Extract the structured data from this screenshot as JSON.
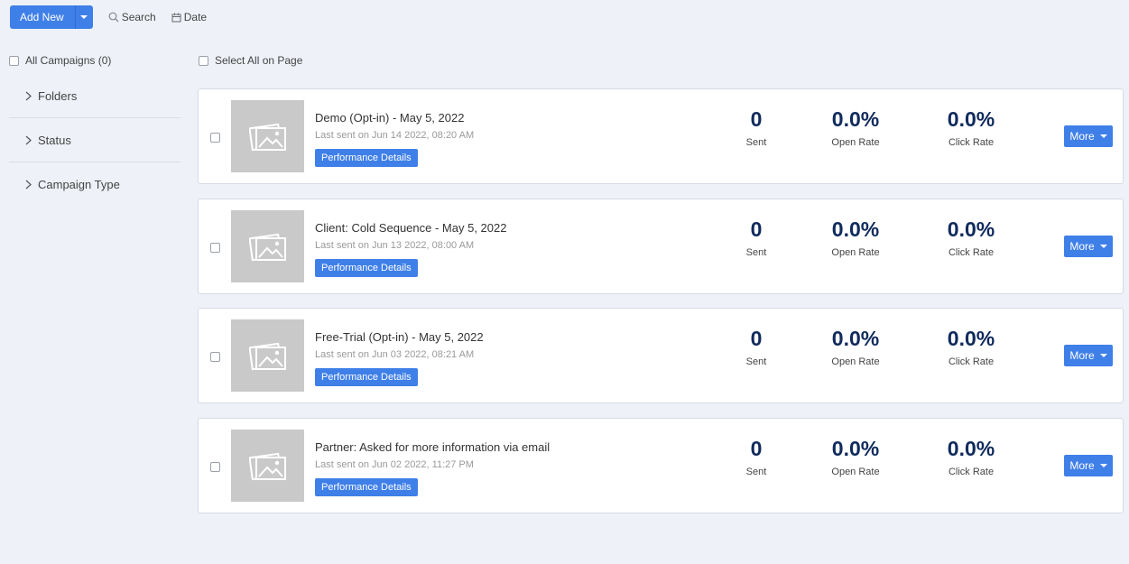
{
  "toolbar": {
    "add_new_label": "Add New",
    "search_label": "Search",
    "date_label": "Date"
  },
  "sidebar": {
    "all_campaigns_label": "All Campaigns (0)",
    "filters": [
      {
        "label": "Folders"
      },
      {
        "label": "Status"
      },
      {
        "label": "Campaign Type"
      }
    ]
  },
  "select_all_label": "Select All on Page",
  "campaigns": [
    {
      "title": "Demo (Opt-in) - May 5, 2022",
      "last_sent": "Last sent on Jun 14 2022, 08:20 AM",
      "performance_label": "Performance Details",
      "sent": "0",
      "sent_label": "Sent",
      "open_rate": "0.0%",
      "open_rate_label": "Open Rate",
      "click_rate": "0.0%",
      "click_rate_label": "Click Rate",
      "more_label": "More"
    },
    {
      "title": "Client: Cold Sequence - May 5, 2022",
      "last_sent": "Last sent on Jun 13 2022, 08:00 AM",
      "performance_label": "Performance Details",
      "sent": "0",
      "sent_label": "Sent",
      "open_rate": "0.0%",
      "open_rate_label": "Open Rate",
      "click_rate": "0.0%",
      "click_rate_label": "Click Rate",
      "more_label": "More"
    },
    {
      "title": "Free-Trial (Opt-in) - May 5, 2022",
      "last_sent": "Last sent on Jun 03 2022, 08:21 AM",
      "performance_label": "Performance Details",
      "sent": "0",
      "sent_label": "Sent",
      "open_rate": "0.0%",
      "open_rate_label": "Open Rate",
      "click_rate": "0.0%",
      "click_rate_label": "Click Rate",
      "more_label": "More"
    },
    {
      "title": "Partner: Asked for more information via email",
      "last_sent": "Last sent on Jun 02 2022, 11:27 PM",
      "performance_label": "Performance Details",
      "sent": "0",
      "sent_label": "Sent",
      "open_rate": "0.0%",
      "open_rate_label": "Open Rate",
      "click_rate": "0.0%",
      "click_rate_label": "Click Rate",
      "more_label": "More"
    }
  ],
  "colors": {
    "accent": "#3f7fe8",
    "stat_number": "#102a5c",
    "background": "#eef1f8",
    "thumbnail": "#c9c9c9"
  },
  "icons": [
    "chevron-down-icon",
    "search-icon",
    "calendar-icon",
    "chevron-right-icon",
    "image-placeholder-icon",
    "caret-down-icon"
  ]
}
